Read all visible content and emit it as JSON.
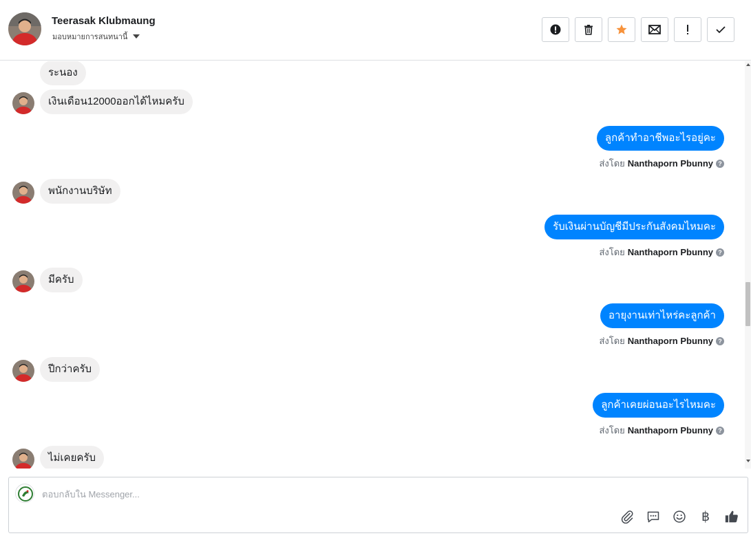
{
  "header": {
    "contact_name": "Teerasak Klubmaung",
    "assign_label": "มอบหมายการสนทนานี้",
    "actions": [
      {
        "name": "report-spam-button",
        "icon": "alert-circle-icon",
        "title": "สแปม"
      },
      {
        "name": "delete-button",
        "icon": "trash-icon",
        "title": "ลบ"
      },
      {
        "name": "star-button",
        "icon": "star-icon",
        "title": "ติดดาว"
      },
      {
        "name": "mark-unread-button",
        "icon": "envelope-icon",
        "title": "ยังไม่ได้อ่าน"
      },
      {
        "name": "follow-up-button",
        "icon": "exclamation-icon",
        "title": "ติดตาม"
      },
      {
        "name": "mark-done-button",
        "icon": "check-icon",
        "title": "เสร็จแล้ว"
      }
    ]
  },
  "sent_by_label": "ส่งโดย",
  "help_glyph": "?",
  "messages": [
    {
      "direction": "in",
      "text": "ระนอง",
      "avatar": false
    },
    {
      "direction": "in",
      "text": "เงินเดือน12000ออกได้ไหมครับ",
      "avatar": true
    },
    {
      "direction": "out",
      "text": "ลูกค้าทำอาชีพอะไรอยู่คะ",
      "sender": "Nanthaporn Pbunny"
    },
    {
      "direction": "in",
      "text": "พนักงานบริษัท",
      "avatar": true
    },
    {
      "direction": "out",
      "text": "รับเงินผ่านบัญชีมีประกันสังคมไหมคะ",
      "sender": "Nanthaporn Pbunny"
    },
    {
      "direction": "in",
      "text": "มีครับ",
      "avatar": true
    },
    {
      "direction": "out",
      "text": "อายุงานเท่าไหร่คะลูกค้า",
      "sender": "Nanthaporn Pbunny"
    },
    {
      "direction": "in",
      "text": "ปีกว่าครับ",
      "avatar": true
    },
    {
      "direction": "out",
      "text": "ลูกค้าเคยผ่อนอะไรไหมคะ",
      "sender": "Nanthaporn Pbunny"
    },
    {
      "direction": "in",
      "text": "ไม่เคยครับ",
      "avatar": true
    }
  ],
  "composer": {
    "placeholder": "ตอบกลับใน Messenger...",
    "tools": [
      "paperclip-icon",
      "saved-reply-icon",
      "emoji-icon",
      "baht-icon",
      "thumbs-up-icon"
    ],
    "baht_glyph": "฿"
  },
  "colors": {
    "outgoing_bubble": "#0084ff",
    "incoming_bubble": "#f1f0f0",
    "star": "#f7923b"
  }
}
